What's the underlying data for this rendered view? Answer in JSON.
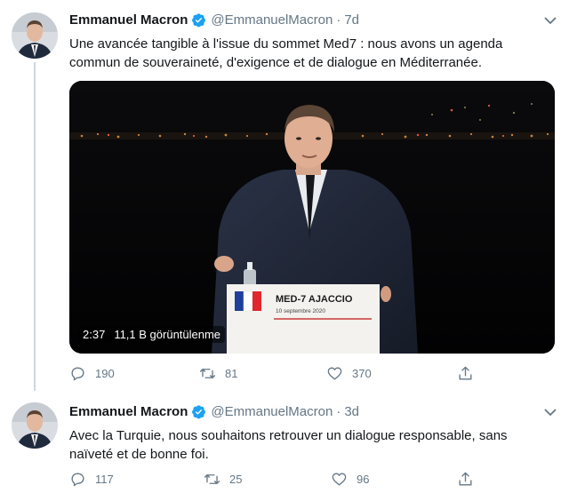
{
  "colors": {
    "text_primary": "#14171a",
    "text_secondary": "#657786",
    "verified_blue": "#1da1f2",
    "thread_line": "#ccd6dd"
  },
  "tweets": [
    {
      "author_name": "Emmanuel Macron",
      "author_handle": "@EmmanuelMacron",
      "separator": "·",
      "time": "7d",
      "text": "Une avancée tangible à l'issue du sommet Med7 : nous avons un agenda\ncommun de souveraineté, d'exigence et de dialogue en Méditerranée.",
      "media": {
        "type": "video",
        "duration": "2:37",
        "views": "11,1 B görüntülenme",
        "podium_title": "MED-7 AJACCIO",
        "podium_date": "10 septembre 2020"
      },
      "actions": {
        "reply_icon": "reply-icon",
        "reply_count": "190",
        "retweet_icon": "retweet-icon",
        "retweet_count": "81",
        "like_icon": "heart-icon",
        "like_count": "370",
        "share_icon": "share-icon"
      }
    },
    {
      "author_name": "Emmanuel Macron",
      "author_handle": "@EmmanuelMacron",
      "separator": "·",
      "time": "3d",
      "text": "Avec la Turquie, nous souhaitons retrouver un dialogue responsable,  sans\nnaïveté et de bonne foi.",
      "actions": {
        "reply_icon": "reply-icon",
        "reply_count": "117",
        "retweet_icon": "retweet-icon",
        "retweet_count": "25",
        "like_icon": "heart-icon",
        "like_count": "96",
        "share_icon": "share-icon"
      }
    }
  ]
}
